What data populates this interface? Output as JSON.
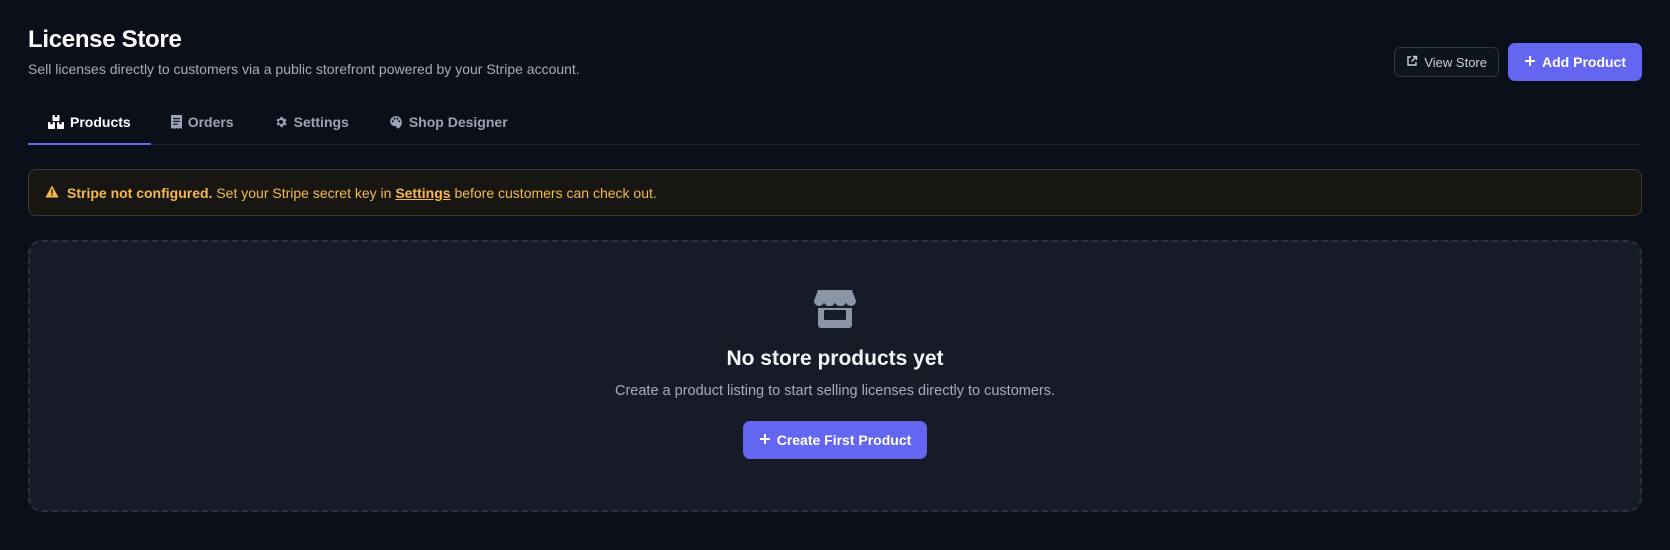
{
  "header": {
    "title": "License Store",
    "subtitle": "Sell licenses directly to customers via a public storefront powered by your Stripe account.",
    "view_store_label": "View Store",
    "add_product_label": "Add Product"
  },
  "tabs": [
    {
      "label": "Products",
      "icon": "boxes-icon",
      "active": true
    },
    {
      "label": "Orders",
      "icon": "receipt-icon",
      "active": false
    },
    {
      "label": "Settings",
      "icon": "gear-icon",
      "active": false
    },
    {
      "label": "Shop Designer",
      "icon": "palette-icon",
      "active": false
    }
  ],
  "alert": {
    "icon": "warning-icon",
    "bold": "Stripe not configured.",
    "text_before": "Set your Stripe secret key in",
    "link": "Settings",
    "text_after": "before customers can check out."
  },
  "empty_state": {
    "icon": "store-icon",
    "title": "No store products yet",
    "description": "Create a product listing to start selling licenses directly to customers.",
    "button_label": "Create First Product"
  },
  "colors": {
    "background": "#0b0f1a",
    "accent": "#6366f1",
    "warning": "#f5b94a",
    "panel": "#161b27"
  }
}
